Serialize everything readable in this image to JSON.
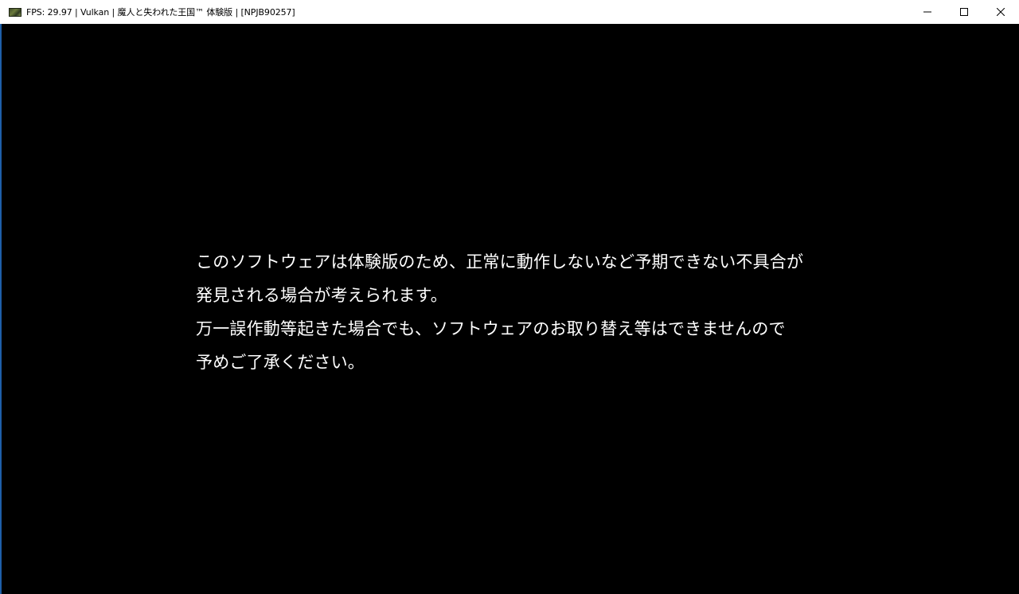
{
  "window": {
    "title": "FPS: 29.97 | Vulkan | 魔人と失われた王国™ 体験版 | [NPJB90257]",
    "app_icon": "game-thumbnail-icon",
    "controls": {
      "minimize": "minimize-icon",
      "maximize": "maximize-icon",
      "close": "close-icon"
    }
  },
  "notice": {
    "lines": [
      "このソフトウェアは体験版のため、正常に動作しないなど予期できない不具合が",
      "発見される場合が考えられます。",
      "万一誤作動等起きた場合でも、ソフトウェアのお取り替え等はできませんので",
      "予めご了承ください。"
    ]
  },
  "colors": {
    "background": "#000000",
    "text": "#ffffff",
    "titlebar": "#ffffff",
    "window_edge": "#1e5fa8"
  }
}
